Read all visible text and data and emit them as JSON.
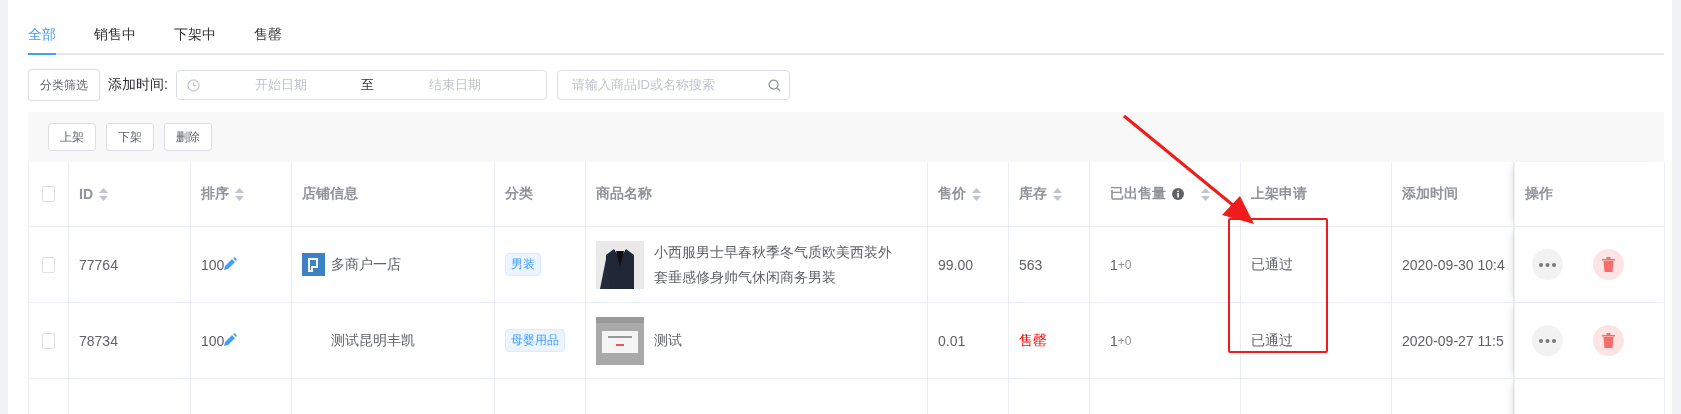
{
  "tabs": [
    {
      "label": "全部",
      "selected": true
    },
    {
      "label": "销售中",
      "selected": false
    },
    {
      "label": "下架中",
      "selected": false
    },
    {
      "label": "售罄",
      "selected": false
    }
  ],
  "filters": {
    "category_button": "分类筛选",
    "date_label": "添加时间:",
    "start_placeholder": "开始日期",
    "separator": "至",
    "end_placeholder": "结束日期",
    "search_placeholder": "请输入商品ID或名称搜索"
  },
  "actions": [
    "上架",
    "下架",
    "删除"
  ],
  "table": {
    "select_all_checked": false,
    "columns": [
      {
        "label": "ID",
        "sortable": true,
        "info": false
      },
      {
        "label": "排序",
        "sortable": true,
        "info": false
      },
      {
        "label": "店铺信息",
        "sortable": false,
        "info": false
      },
      {
        "label": "分类",
        "sortable": false,
        "info": false
      },
      {
        "label": "商品名称",
        "sortable": false,
        "info": false
      },
      {
        "label": "售价",
        "sortable": true,
        "info": false
      },
      {
        "label": "库存",
        "sortable": true,
        "info": false
      },
      {
        "label": "已出售量",
        "sortable": true,
        "info": true
      },
      {
        "label": "上架申请",
        "sortable": false,
        "info": false
      },
      {
        "label": "添加时间",
        "sortable": false,
        "info": false
      },
      {
        "label": "操作",
        "sortable": false,
        "info": false
      }
    ],
    "rows": [
      {
        "checked": false,
        "id": "77764",
        "sort": "100",
        "store": {
          "name": "多商户一店",
          "logo": true
        },
        "category": "男装",
        "product": {
          "kind": "picture",
          "name": "小西服男士早春秋季冬气质欧美西装外套垂感修身帅气休闲商务男装"
        },
        "price": "99.00",
        "stock": "563",
        "sold_out": false,
        "sold": "1",
        "sold_extra": "+0",
        "approval": "已通过",
        "added": "2020-09-30 10:4"
      },
      {
        "checked": false,
        "id": "78734",
        "sort": "100",
        "store": {
          "name": "测试昆明丰凯",
          "logo": false
        },
        "category": "母婴用品",
        "product": {
          "kind": "picture",
          "name": "测试"
        },
        "price": "0.01",
        "stock": "售罄",
        "sold_out": true,
        "sold": "1",
        "sold_extra": "+0",
        "approval": "已通过",
        "added": "2020-09-27 11:5"
      }
    ]
  }
}
